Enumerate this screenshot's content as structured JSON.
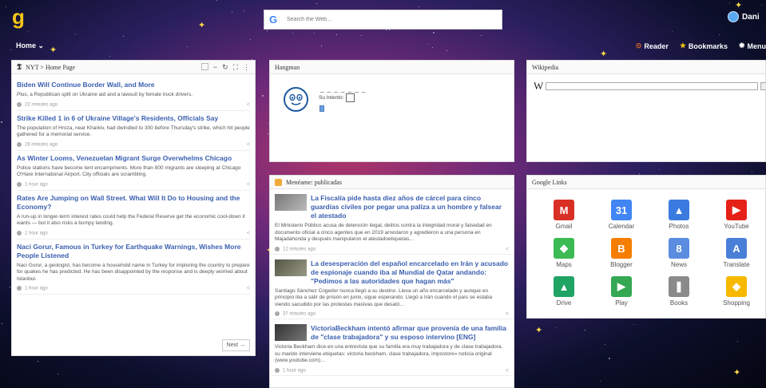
{
  "topbar": {
    "logo": "g",
    "search_placeholder": "Search the Web...",
    "user_name": "Dani"
  },
  "nav": {
    "home_label": "Home",
    "reader_label": "Reader",
    "bookmarks_label": "Bookmarks",
    "menu_label": "Menu"
  },
  "nyt": {
    "title": "NYT > Home Page",
    "items": [
      {
        "title": "Biden Will Continue Border Wall, and More",
        "summary": "Plus, a Republican split on Ukraine aid and a lawsuit by female truck drivers.",
        "time": "22 minutes ago"
      },
      {
        "title": "Strike Killed 1 in 6 of Ukraine Village's Residents, Officials Say",
        "summary": "The population of Hroza, near Kharkiv, had dwindled to 300 before Thursday's strike, which hit people gathered for a memorial service.",
        "time": "28 minutes ago"
      },
      {
        "title": "As Winter Looms, Venezuelan Migrant Surge Overwhelms Chicago",
        "summary": "Police stations have become tent encampments. More than 800 migrants are sleeping at Chicago O'Hare International Airport. City officials are scrambling.",
        "time": "1 hour ago"
      },
      {
        "title": "Rates Are Jumping on Wall Street. What Will It Do to Housing and the Economy?",
        "summary": "A run-up in longer-term interest rates could help the Federal Reserve get the economic cool-down it wants — but it also risks a bumpy landing.",
        "time": "1 hour ago"
      },
      {
        "title": "Naci Gorur, Famous in Turkey for Earthquake Warnings, Wishes More People Listened",
        "summary": "Naci Gorur, a geologist, has become a household name in Turkey for imploring the country to prepare for quakes he has predicted. He has been disappointed by the response and is deeply worried about Istanbul.",
        "time": "1 hour ago"
      }
    ],
    "next_label": "Next →"
  },
  "hangman": {
    "title": "Hangman",
    "dashes": "_ _ _ _ _ _ _",
    "intento_label": "Su Intento:"
  },
  "wikipedia": {
    "title": "Wikipedia",
    "logo": "W"
  },
  "meneame": {
    "title": "Menéame: publicadas",
    "items": [
      {
        "title": "La Fiscalía pide hasta diez años de cárcel para cinco guardias civiles por pegar una paliza a un hombre y falsear el atestado",
        "summary": "El Ministerio Público acusa de detención ilegal, delitos contra la integridad moral y falsedad en documento oficial a cinco agentes que en 2019 arrestaron y agredieron a una persona en Majadahonda y después manipularon el atestadoetiquetas…",
        "time": "12 minutes ago"
      },
      {
        "title": "La desesperación del español encarcelado en Irán y acusado de espionaje cuando iba al Mundial de Qatar andando: \"Pedimos a las autoridades que hagan más\"",
        "summary": "Santiago Sánchez Cogedor nunca llegó a su destino. Lleva un año encarcelado y aunque en principio iba a salir de prisión en junio, sigue esperando. Llegó a Irán cuando el país se estaba viendo sacudido por las protestas masivas que desató…",
        "time": "37 minutes ago"
      },
      {
        "title": "VictoriaBeckham intentó afirmar que provenía de una familia de \"clase trabajadora\" y su esposo intervino [ENG]",
        "summary": "Victoria Beckham dice en una entrevista que su familia era muy trabajadora y de clase trabajadora, su marido interviene.etiquetas: victoria beckham, clase trabajadora, impostore» noticia original (www.youtube.com)…",
        "time": "1 hour ago"
      }
    ]
  },
  "google_links": {
    "title": "Google Links",
    "apps": [
      {
        "label": "Gmail",
        "glyph": "M",
        "color": "#d93025"
      },
      {
        "label": "Calendar",
        "glyph": "31",
        "color": "#4285f4"
      },
      {
        "label": "Photos",
        "glyph": "▲",
        "color": "#3a7be0"
      },
      {
        "label": "YouTube",
        "glyph": "▶",
        "color": "#e62117"
      },
      {
        "label": "Maps",
        "glyph": "◆",
        "color": "#3cba54"
      },
      {
        "label": "Blogger",
        "glyph": "B",
        "color": "#f57d00"
      },
      {
        "label": "News",
        "glyph": "8",
        "color": "#5a8de0"
      },
      {
        "label": "Translate",
        "glyph": "A",
        "color": "#4a7fd8"
      },
      {
        "label": "Drive",
        "glyph": "▲",
        "color": "#1fa463"
      },
      {
        "label": "Play",
        "glyph": "▶",
        "color": "#34a853"
      },
      {
        "label": "Books",
        "glyph": "❚",
        "color": "#8a8a8a"
      },
      {
        "label": "Shopping",
        "glyph": "◆",
        "color": "#f6b900"
      }
    ]
  }
}
